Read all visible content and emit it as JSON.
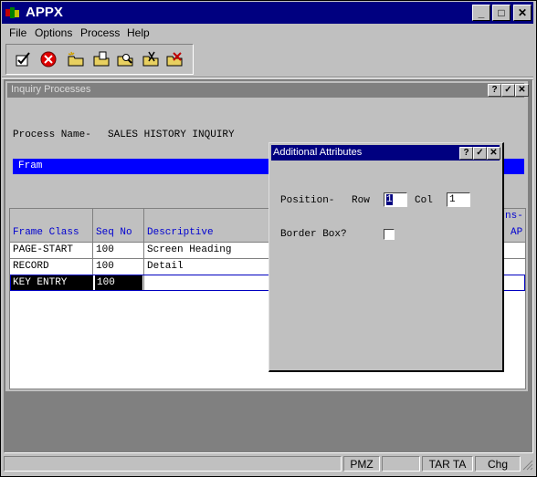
{
  "app": {
    "title": "APPX"
  },
  "title_buttons": {
    "minimize": "_",
    "maximize": "□",
    "close": "✕"
  },
  "menu": [
    "File",
    "Options",
    "Process",
    "Help"
  ],
  "toolbar_icons": [
    "ok-check-icon",
    "cancel-icon",
    "new-folder-icon",
    "open-folder-icon",
    "search-folder-icon",
    "cut-folder-icon",
    "delete-folder-icon"
  ],
  "inquiry": {
    "title": "Inquiry Processes",
    "process_label": "Process Name-",
    "process_name": "SALES HISTORY INQUIRY",
    "blue_bar": "Fram",
    "columns": {
      "frame_class": "Frame Class",
      "seq_no": "Seq No",
      "descriptive": "Descriptive",
      "right_top": "ns-",
      "right_bottom": "AP"
    },
    "rows": [
      {
        "frame_class": "PAGE-START",
        "seq_no": "100",
        "descriptive": "Screen Heading"
      },
      {
        "frame_class": "RECORD",
        "seq_no": "100",
        "descriptive": "Detail"
      },
      {
        "frame_class": "KEY ENTRY",
        "seq_no": "100",
        "descriptive": ""
      }
    ],
    "buttons": {
      "help": "?",
      "ok": "✓",
      "close": "✕"
    }
  },
  "dialog": {
    "title": "Additional Attributes",
    "position_label": "Position-",
    "row_label": "Row",
    "row_value": "1",
    "col_label": "Col",
    "col_value": "1",
    "border_box_label": "Border Box?",
    "buttons": {
      "help": "?",
      "ok": "✓",
      "close": "✕"
    }
  },
  "status": {
    "p1": "",
    "p2": "",
    "pmz": "PMZ",
    "p4": "",
    "tar": "TAR TA",
    "chg": "Chg"
  },
  "colors": {
    "title_blue": "#000080",
    "field_blue": "#0000ff",
    "label_blue": "#0000d0"
  }
}
